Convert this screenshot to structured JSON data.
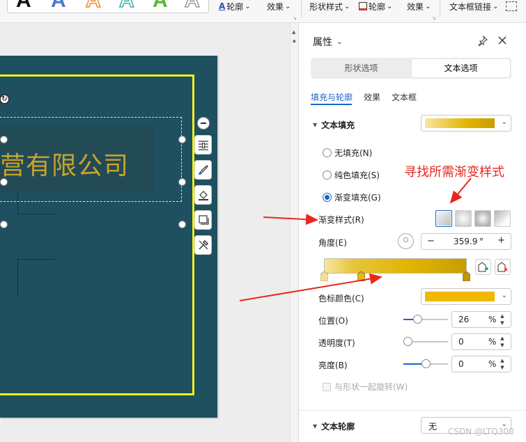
{
  "toolbar": {
    "gallery_glyph": "A",
    "outline_label": "轮廓",
    "effect_label": "效果",
    "shape_style_label": "形状样式",
    "outline2_label": "轮廓",
    "effect2_label": "效果",
    "textbox_link_label": "文本框链接",
    "dropdown_arrow": "⌄"
  },
  "panel": {
    "title": "属性",
    "tabs": [
      {
        "label": "形状选项",
        "active": false
      },
      {
        "label": "文本选项",
        "active": true
      }
    ],
    "subtabs": [
      {
        "label": "填充与轮廓",
        "active": true
      },
      {
        "label": "效果",
        "active": false
      },
      {
        "label": "文本框",
        "active": false
      }
    ],
    "text_fill": {
      "title": "文本填充",
      "options": [
        {
          "label": "无填充(N)",
          "checked": false
        },
        {
          "label": "纯色填充(S)",
          "checked": false
        },
        {
          "label": "渐变填充(G)",
          "checked": true
        }
      ],
      "gradient_style_label": "渐变样式(R)",
      "angle_label": "角度(E)",
      "angle_value": "359.9",
      "angle_unit": "°",
      "stop_color_label": "色标颜色(C)",
      "position_label": "位置(O)",
      "position_value": "26",
      "transparency_label": "透明度(T)",
      "transparency_value": "0",
      "brightness_label": "亮度(B)",
      "brightness_value": "0",
      "percent": "%",
      "rotate_with_shape_label": "与形状一起旋转(W)",
      "minus": "−",
      "plus": "+"
    },
    "text_outline": {
      "title": "文本轮廓",
      "value": "无"
    }
  },
  "slide": {
    "title_text": "营有限公司"
  },
  "annotation": {
    "text": "寻找所需渐变样式"
  },
  "watermark": "CSDN @LTQ300",
  "colors": {
    "accent": "#1a63c8",
    "slide_bg": "#1e5060",
    "frame": "#f4ef1a",
    "title_gold": "#c9a32a",
    "stop_color": "#f0b800",
    "annotation_red": "#e8271f"
  },
  "values": {
    "position_fraction": 0.26,
    "transparency_fraction": 0.0,
    "brightness_fraction": 0.5
  }
}
